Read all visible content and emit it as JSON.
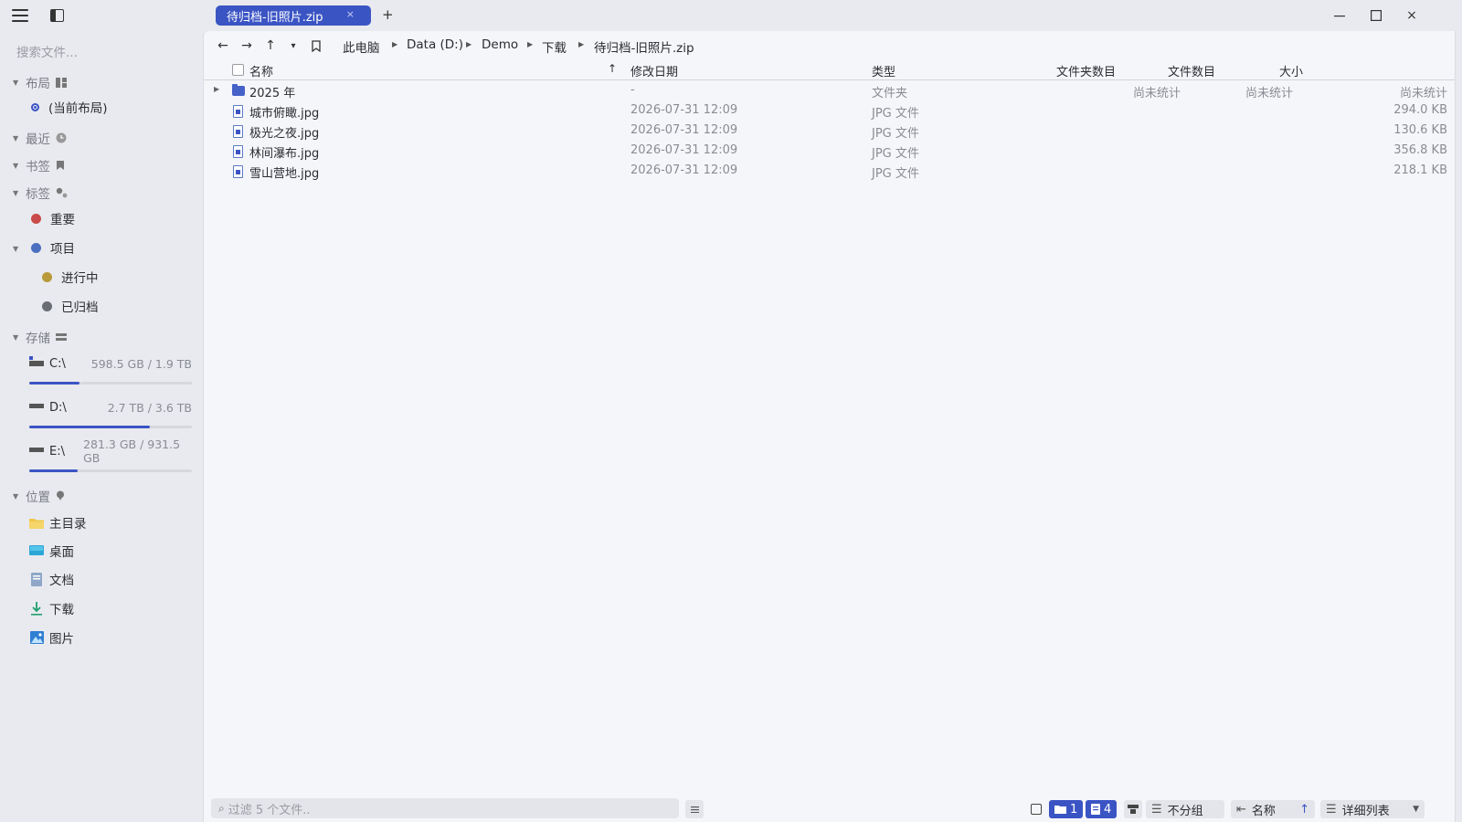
{
  "window": {
    "tab_title": "待归档-旧照片.zip",
    "tab_close": "×",
    "tab_add": "+",
    "minimize": "—",
    "maximize": "☐",
    "close": "×"
  },
  "sidebar": {
    "search_placeholder": "搜索文件...",
    "layout": {
      "label": "布局",
      "current": "(当前布局)"
    },
    "recent": {
      "label": "最近"
    },
    "bookmarks": {
      "label": "书签"
    },
    "tags": {
      "label": "标签",
      "items": [
        {
          "label": "重要",
          "color": "#c94a4a"
        },
        {
          "label": "项目",
          "color": "#4a6fbf"
        },
        {
          "label": "进行中",
          "color": "#b89a3a"
        },
        {
          "label": "已归档",
          "color": "#6b6d75"
        }
      ]
    },
    "storage": {
      "label": "存储",
      "drives": [
        {
          "name": "C:\\",
          "size": "598.5 GB / 1.9 TB",
          "used_fraction": 0.31
        },
        {
          "name": "D:\\",
          "size": "2.7 TB / 3.6 TB",
          "used_fraction": 0.74
        },
        {
          "name": "E:\\",
          "size": "281.3 GB / 931.5 GB",
          "used_fraction": 0.3
        }
      ]
    },
    "locations": {
      "label": "位置",
      "items": [
        {
          "label": "主目录",
          "icon": "folder-icon"
        },
        {
          "label": "桌面",
          "icon": "desktop-icon"
        },
        {
          "label": "文档",
          "icon": "document-icon"
        },
        {
          "label": "下载",
          "icon": "download-icon"
        },
        {
          "label": "图片",
          "icon": "picture-icon"
        }
      ]
    }
  },
  "navbar": {
    "back": "←",
    "forward": "→",
    "up": "↑",
    "history": "▾",
    "breadcrumb": [
      "此电脑",
      "Data (D:)",
      "Demo",
      "下载",
      "待归档-旧照片.zip"
    ]
  },
  "columns": {
    "name": "名称",
    "sort_arrow": "↑",
    "modified": "修改日期",
    "type": "类型",
    "folder_count": "文件夹数目",
    "file_count": "文件数目",
    "size": "大小"
  },
  "rows": [
    {
      "name": "2025 年",
      "modified": "-",
      "type": "文件夹",
      "folder_count": "尚未统计",
      "file_count": "尚未统计",
      "size": "尚未统计",
      "kind": "folder"
    },
    {
      "name": "城市俯瞰.jpg",
      "modified": "2026-07-31 12:09",
      "type": "JPG 文件",
      "folder_count": "",
      "file_count": "",
      "size": "294.0 KB",
      "kind": "file"
    },
    {
      "name": "极光之夜.jpg",
      "modified": "2026-07-31 12:09",
      "type": "JPG 文件",
      "folder_count": "",
      "file_count": "",
      "size": "130.6 KB",
      "kind": "file"
    },
    {
      "name": "林间瀑布.jpg",
      "modified": "2026-07-31 12:09",
      "type": "JPG 文件",
      "folder_count": "",
      "file_count": "",
      "size": "356.8 KB",
      "kind": "file"
    },
    {
      "name": "雪山营地.jpg",
      "modified": "2026-07-31 12:09",
      "type": "JPG 文件",
      "folder_count": "",
      "file_count": "",
      "size": "218.1 KB",
      "kind": "file"
    }
  ],
  "statusbar": {
    "filter_placeholder": "过滤 5 个文件..",
    "folders_count": "1",
    "files_count": "4",
    "group": "不分组",
    "sort": "名称",
    "sort_dir": "↑",
    "view": "详细列表"
  },
  "colors": {
    "accent": "#3b54c4",
    "sidebar_bg": "#e9eaef",
    "content_bg": "#f5f6f9"
  }
}
